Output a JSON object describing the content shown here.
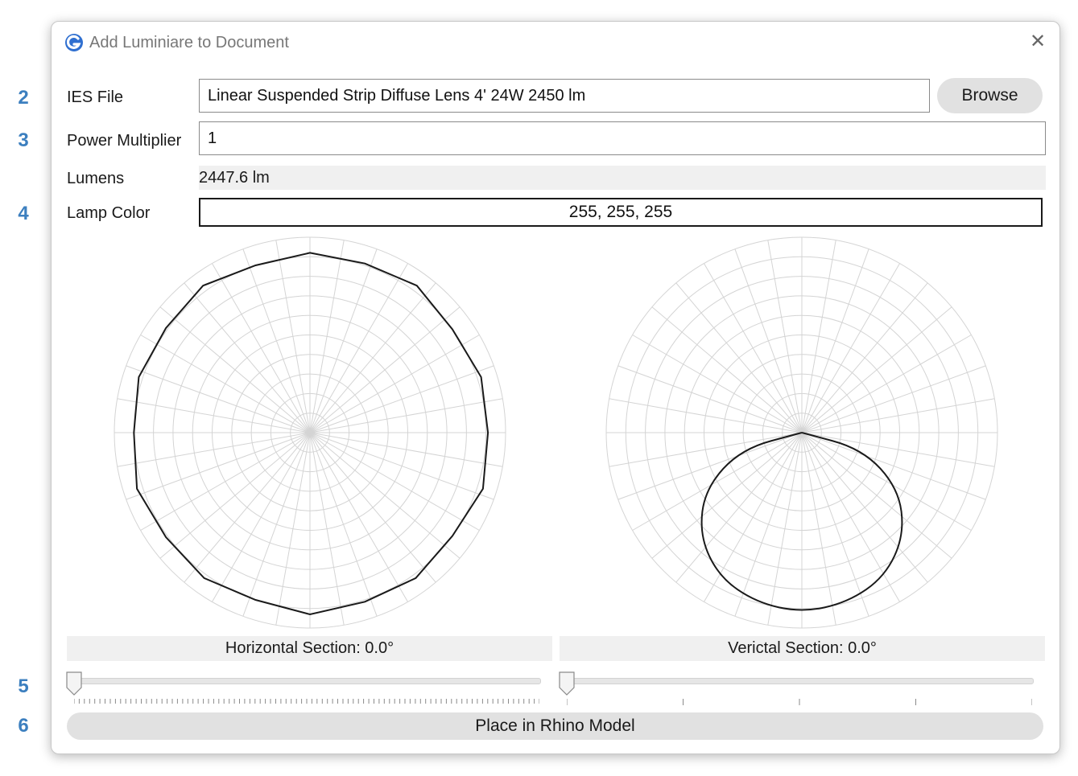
{
  "callouts": [
    "2",
    "3",
    "4",
    "5",
    "6"
  ],
  "dialog": {
    "title": "Add Luminiare to Document",
    "close_glyph": "✕",
    "app_icon": "app-logo-icon"
  },
  "fields": {
    "ies_file": {
      "label": "IES File",
      "value": "Linear Suspended Strip Diffuse Lens 4' 24W 2450 lm"
    },
    "browse_label": "Browse",
    "power_multiplier": {
      "label": "Power Multiplier",
      "value": "1"
    },
    "lumens": {
      "label": "Lumens",
      "value": "2447.6 lm"
    },
    "lamp_color": {
      "label": "Lamp Color",
      "value": "255, 255, 255"
    }
  },
  "sections": {
    "horizontal": {
      "label": "Horizontal Section: 0.0°",
      "value_deg": 0.0
    },
    "vertical": {
      "label": "Verictal Section: 0.0°",
      "value_deg": 0.0
    }
  },
  "place_label": "Place in Rhino Model",
  "colors": {
    "accent_callout": "#3c7fbf",
    "grid": "#d4d4d4",
    "curve": "#1a1a1a",
    "button_bg": "#e1e1e1"
  },
  "chart_data": [
    {
      "type": "polar",
      "name": "horizontal-distribution",
      "shape": "near-circular polygon",
      "relative_radius": [
        0.92,
        0.91,
        0.93,
        0.9,
        0.92,
        0.91,
        0.93,
        0.9,
        0.92,
        0.91,
        0.93,
        0.9,
        0.92,
        0.91,
        0.93,
        0.9,
        0.92,
        0.91,
        0.93,
        0.9
      ]
    },
    {
      "type": "polar",
      "name": "vertical-distribution",
      "shape": "downward lobe",
      "relative_radius_by_angle_from_nadir_deg": [
        [
          0,
          0.92
        ],
        [
          15,
          0.9
        ],
        [
          30,
          0.85
        ],
        [
          45,
          0.74
        ],
        [
          60,
          0.57
        ],
        [
          75,
          0.32
        ],
        [
          90,
          0.0
        ]
      ]
    }
  ]
}
